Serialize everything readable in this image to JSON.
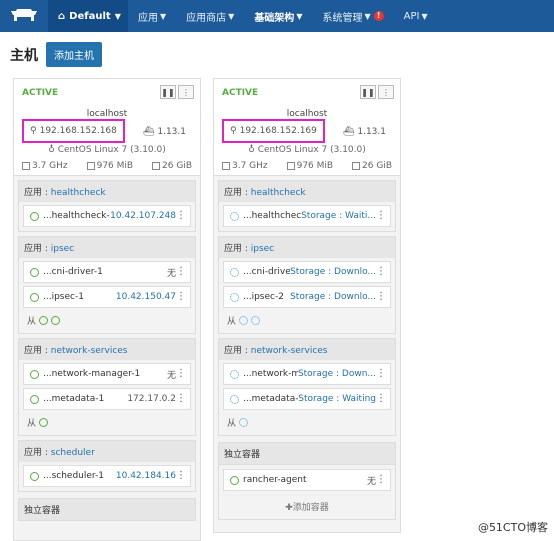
{
  "topbar": {
    "logo_icon": "cow-logo-icon",
    "env_label": "Default",
    "menu": [
      {
        "label": "应用"
      },
      {
        "label": "应用商店"
      },
      {
        "label": "基础架构"
      },
      {
        "label": "系统管理"
      },
      {
        "label": "API"
      }
    ],
    "alert_badge": "!"
  },
  "header": {
    "title": "主机",
    "add_host_label": "添加主机"
  },
  "hosts": [
    {
      "state": "ACTIVE",
      "hostname": "localhost",
      "ip": "192.168.152.168",
      "docker": "1.13.1",
      "os": "CentOS Linux 7 (3.10.0)",
      "cpu": "3.7 GHz",
      "mem": "976 MiB",
      "disk": "26 GiB",
      "stacks": [
        {
          "prefix": "应用 : ",
          "name": "healthcheck",
          "containers": [
            {
              "name": "...healthcheck-1",
              "info": "10.42.107.248"
            }
          ]
        },
        {
          "prefix": "应用 : ",
          "name": "ipsec",
          "containers": [
            {
              "name": "...cni-driver-1",
              "info": "无"
            },
            {
              "name": "...ipsec-1",
              "info": "10.42.150.47"
            }
          ],
          "sidekick": "从"
        },
        {
          "prefix": "应用 : ",
          "name": "network-services",
          "containers": [
            {
              "name": "...network-manager-1",
              "info": "无"
            },
            {
              "name": "...metadata-1",
              "info": "172.17.0.2"
            }
          ],
          "sidekick": "从"
        },
        {
          "prefix": "应用 : ",
          "name": "scheduler",
          "containers": [
            {
              "name": "...scheduler-1",
              "info": "10.42.184.16"
            }
          ]
        }
      ],
      "standalone": "独立容器"
    },
    {
      "state": "ACTIVE",
      "hostname": "localhost",
      "ip": "192.168.152.169",
      "docker": "1.13.1",
      "os": "CentOS Linux 7 (3.10.0)",
      "cpu": "3.7 GHz",
      "mem": "976 MiB",
      "disk": "26 GiB",
      "stacks": [
        {
          "prefix": "应用 : ",
          "name": "healthcheck",
          "containers": [
            {
              "name": "...healthcheck...",
              "info": "Storage : Waiti..."
            }
          ]
        },
        {
          "prefix": "应用 : ",
          "name": "ipsec",
          "containers": [
            {
              "name": "...cni-drive...",
              "info": "Storage : Downlo..."
            },
            {
              "name": "...ipsec-2",
              "info": "Storage : Downlo..."
            }
          ],
          "sidekick": "从"
        },
        {
          "prefix": "应用 : ",
          "name": "network-services",
          "containers": [
            {
              "name": "...network-m...",
              "info": "Storage : Down..."
            },
            {
              "name": "...metadata-2",
              "info": "Storage : Waiting"
            }
          ],
          "sidekick": "从"
        }
      ],
      "standalone": "独立容器",
      "standalone_containers": [
        {
          "name": "rancher-agent",
          "info": "无"
        }
      ],
      "add_container": "添加容器"
    }
  ],
  "watermark": "@51CTO博客"
}
